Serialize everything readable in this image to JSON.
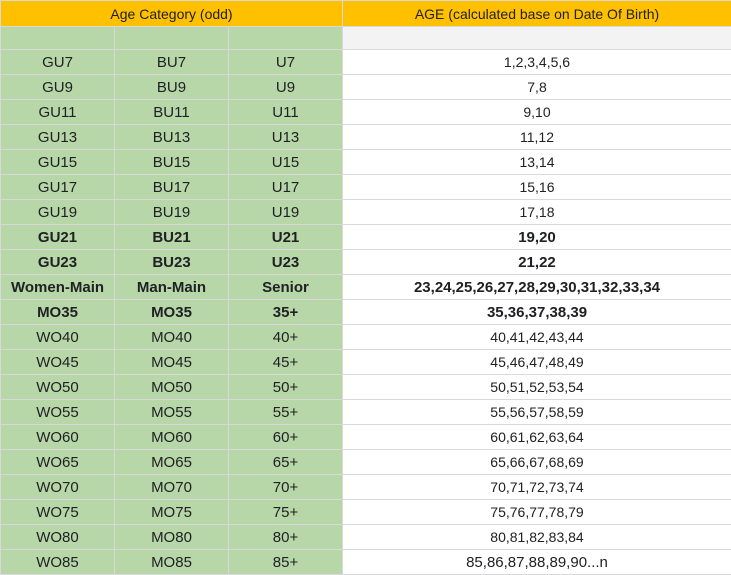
{
  "header": {
    "category": "Age Category (odd)",
    "age": "AGE (calculated base on Date Of Birth)"
  },
  "rows": [
    {
      "women": "",
      "men": "",
      "group": "",
      "ages": "",
      "bold": false
    },
    {
      "women": "GU7",
      "men": "BU7",
      "group": "U7",
      "ages": "1,2,3,4,5,6",
      "bold": false
    },
    {
      "women": "GU9",
      "men": "BU9",
      "group": "U9",
      "ages": "7,8",
      "bold": false
    },
    {
      "women": "GU11",
      "men": "BU11",
      "group": "U11",
      "ages": "9,10",
      "bold": false
    },
    {
      "women": "GU13",
      "men": "BU13",
      "group": "U13",
      "ages": "11,12",
      "bold": false
    },
    {
      "women": "GU15",
      "men": "BU15",
      "group": "U15",
      "ages": "13,14",
      "bold": false
    },
    {
      "women": "GU17",
      "men": "BU17",
      "group": "U17",
      "ages": "15,16",
      "bold": false
    },
    {
      "women": "GU19",
      "men": "BU19",
      "group": "U19",
      "ages": "17,18",
      "bold": false
    },
    {
      "women": "GU21",
      "men": "BU21",
      "group": "U21",
      "ages": "19,20",
      "bold": true
    },
    {
      "women": "GU23",
      "men": "BU23",
      "group": "U23",
      "ages": "21,22",
      "bold": true
    },
    {
      "women": "Women-Main",
      "men": "Man-Main",
      "group": "Senior",
      "ages": "23,24,25,26,27,28,29,30,31,32,33,34",
      "bold": true
    },
    {
      "women": "MO35",
      "men": "MO35",
      "group": "35+",
      "ages": "35,36,37,38,39",
      "bold": true
    },
    {
      "women": "WO40",
      "men": "MO40",
      "group": "40+",
      "ages": "40,41,42,43,44",
      "bold": false
    },
    {
      "women": "WO45",
      "men": "MO45",
      "group": "45+",
      "ages": "45,46,47,48,49",
      "bold": false
    },
    {
      "women": "WO50",
      "men": "MO50",
      "group": "50+",
      "ages": "50,51,52,53,54",
      "bold": false
    },
    {
      "women": "WO55",
      "men": "MO55",
      "group": "55+",
      "ages": "55,56,57,58,59",
      "bold": false
    },
    {
      "women": "WO60",
      "men": "MO60",
      "group": "60+",
      "ages": "60,61,62,63,64",
      "bold": false
    },
    {
      "women": "WO65",
      "men": "MO65",
      "group": "65+",
      "ages": "65,66,67,68,69",
      "bold": false
    },
    {
      "women": "WO70",
      "men": "MO70",
      "group": "70+",
      "ages": "70,71,72,73,74",
      "bold": false
    },
    {
      "women": "WO75",
      "men": "MO75",
      "group": "75+",
      "ages": "75,76,77,78,79",
      "bold": false
    },
    {
      "women": "WO80",
      "men": "MO80",
      "group": "80+",
      "ages": "80,81,82,83,84",
      "bold": false
    },
    {
      "women": "WO85",
      "men": "MO85",
      "group": "85+",
      "ages": "85,86,87,88,89,90...n",
      "bold": false
    }
  ],
  "colors": {
    "header_bg": "#ffc000",
    "category_bg": "#b7d7a8",
    "grid": "#d9d9d9"
  }
}
